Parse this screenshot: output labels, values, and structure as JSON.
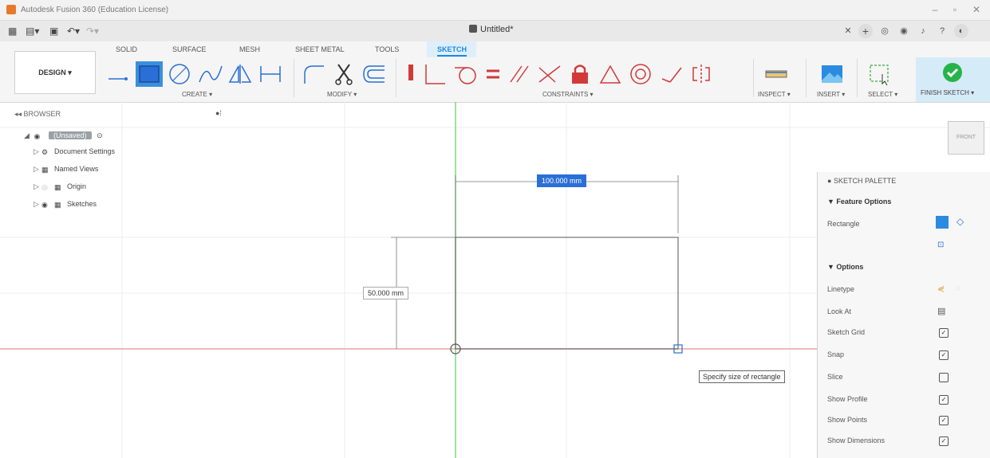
{
  "window": {
    "title": "Autodesk Fusion 360 (Education License)"
  },
  "document": {
    "tab_title": "Untitled*"
  },
  "ribbon": {
    "tabs": [
      "SOLID",
      "SURFACE",
      "MESH",
      "SHEET METAL",
      "TOOLS",
      "SKETCH"
    ],
    "active_tab": "SKETCH",
    "workspace_label": "DESIGN ▾",
    "groups": {
      "create": "CREATE ▾",
      "modify": "MODIFY ▾",
      "constraints": "CONSTRAINTS ▾",
      "inspect": "INSPECT ▾",
      "insert": "INSERT ▾",
      "select": "SELECT ▾",
      "finish": "FINISH SKETCH ▾"
    }
  },
  "browser": {
    "header": "BROWSER",
    "root_label": "(Unsaved)",
    "items": [
      "Document Settings",
      "Named Views",
      "Origin",
      "Sketches"
    ]
  },
  "canvas": {
    "dim_width": "100.000 mm",
    "dim_height": "50.000 mm",
    "tooltip": "Specify size of rectangle",
    "viewcube_face": "FRONT"
  },
  "palette": {
    "title": "SKETCH PALETTE",
    "feature_options_header": "▼ Feature Options",
    "rectangle_label": "Rectangle",
    "options_header": "▼ Options",
    "options": [
      {
        "label": "Linetype",
        "checked": null
      },
      {
        "label": "Look At",
        "checked": null
      },
      {
        "label": "Sketch Grid",
        "checked": true
      },
      {
        "label": "Snap",
        "checked": true
      },
      {
        "label": "Slice",
        "checked": false
      },
      {
        "label": "Show Profile",
        "checked": true
      },
      {
        "label": "Show Points",
        "checked": true
      },
      {
        "label": "Show Dimensions",
        "checked": true
      }
    ]
  },
  "colors": {
    "accent": "#1a8be0",
    "axis_red": "#e06b6b",
    "axis_green": "#5bd35b",
    "finish_green": "#27b34a"
  }
}
